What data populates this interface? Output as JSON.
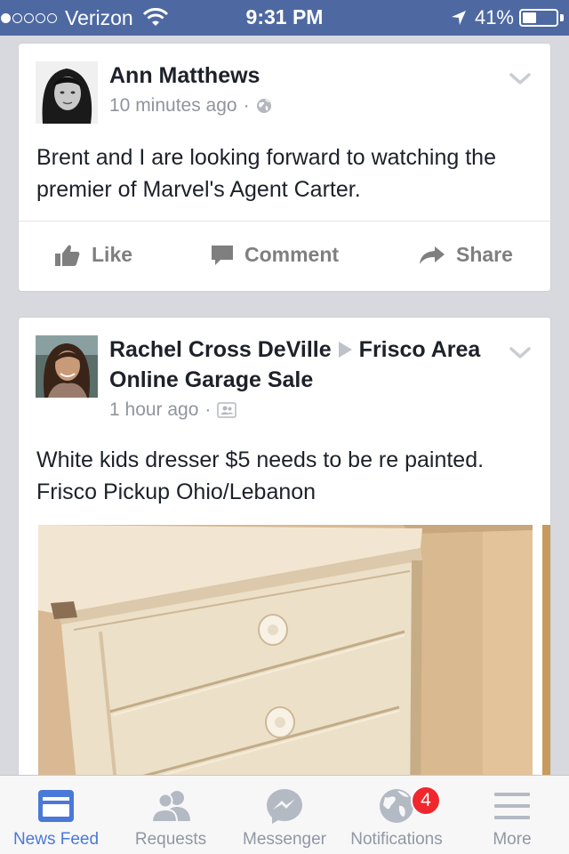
{
  "status_bar": {
    "carrier": "Verizon",
    "signal_bars_filled": 1,
    "signal_bars_total": 5,
    "time": "9:31 PM",
    "battery_percent": "41%",
    "battery_level": 0.41
  },
  "posts": [
    {
      "author": "Ann Matthews",
      "timestamp": "10 minutes ago",
      "separator": "·",
      "privacy_icon": "globe-icon",
      "text": "Brent and I are looking forward to watching the premier of Marvel's Agent Carter.",
      "actions": {
        "like": "Like",
        "comment": "Comment",
        "share": "Share"
      }
    },
    {
      "author": "Rachel Cross DeVille",
      "target": "Frisco Area Online Garage Sale",
      "timestamp": "1 hour ago",
      "separator": "·",
      "privacy_icon": "group-icon",
      "text": "White kids dresser $5 needs to be re painted. Frisco Pickup Ohio/Lebanon"
    }
  ],
  "tab_bar": {
    "tabs": [
      {
        "label": "News Feed",
        "icon": "news-feed-icon",
        "active": true
      },
      {
        "label": "Requests",
        "icon": "friend-requests-icon",
        "active": false
      },
      {
        "label": "Messenger",
        "icon": "messenger-icon",
        "active": false
      },
      {
        "label": "Notifications",
        "icon": "globe-icon",
        "active": false,
        "badge": "4"
      },
      {
        "label": "More",
        "icon": "menu-icon",
        "active": false
      }
    ]
  },
  "colors": {
    "brand_blue": "#4e69a2",
    "active_tab": "#4a79d8",
    "badge_red": "#f0282d",
    "background": "#d7d9de"
  }
}
